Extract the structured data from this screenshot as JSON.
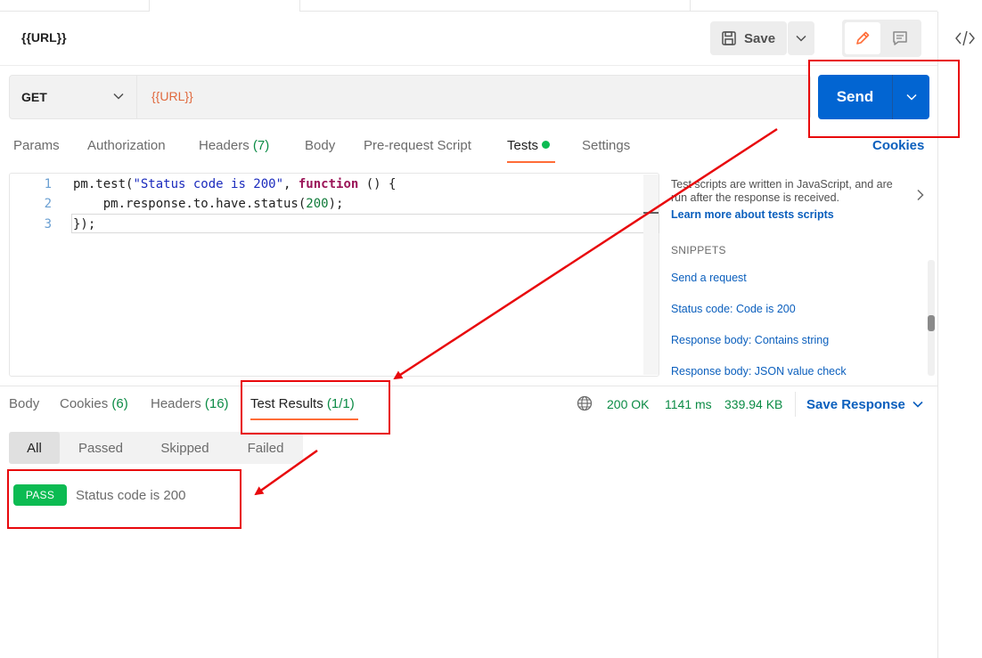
{
  "request": {
    "title": "{{URL}}",
    "method": "GET",
    "url": "{{URL}}"
  },
  "toolbar": {
    "save_label": "Save",
    "send_label": "Send"
  },
  "request_tabs": [
    {
      "label": "Params"
    },
    {
      "label": "Authorization"
    },
    {
      "label": "Headers",
      "count": "(7)"
    },
    {
      "label": "Body"
    },
    {
      "label": "Pre-request Script"
    },
    {
      "label": "Tests"
    },
    {
      "label": "Settings"
    }
  ],
  "cookies_label": "Cookies",
  "editor": {
    "line_numbers": [
      "1",
      "2",
      "3"
    ],
    "lines": {
      "l1_a": "pm.test(",
      "l1_str": "\"Status code is 200\"",
      "l1_b": ", ",
      "l1_kw": "function",
      "l1_c": " () {",
      "l2_a": "    pm.response.to.have.status(",
      "l2_num": "200",
      "l2_b": ");",
      "l3": "});"
    }
  },
  "side_panel": {
    "description": "Test scripts are written in JavaScript, and are run after the response is received.",
    "learn_link": "Learn more about tests scripts",
    "snippets_heading": "SNIPPETS",
    "snippets": [
      "Send a request",
      "Status code: Code is 200",
      "Response body: Contains string",
      "Response body: JSON value check"
    ]
  },
  "response_tabs": [
    {
      "label": "Body"
    },
    {
      "label": "Cookies",
      "count": "(6)"
    },
    {
      "label": "Headers",
      "count": "(16)"
    },
    {
      "label": "Test Results",
      "count": "(1/1)"
    }
  ],
  "response_status": {
    "status": "200 OK",
    "time": "1141 ms",
    "size": "339.94 KB",
    "save_response": "Save Response"
  },
  "result_filters": [
    "All",
    "Passed",
    "Skipped",
    "Failed"
  ],
  "results": [
    {
      "badge": "PASS",
      "name": "Status code is 200"
    }
  ],
  "colors": {
    "accent_orange": "#ff6c37",
    "send_blue": "#0265d2",
    "pass_green": "#0cbb52",
    "annotation_red": "#e8080c"
  }
}
